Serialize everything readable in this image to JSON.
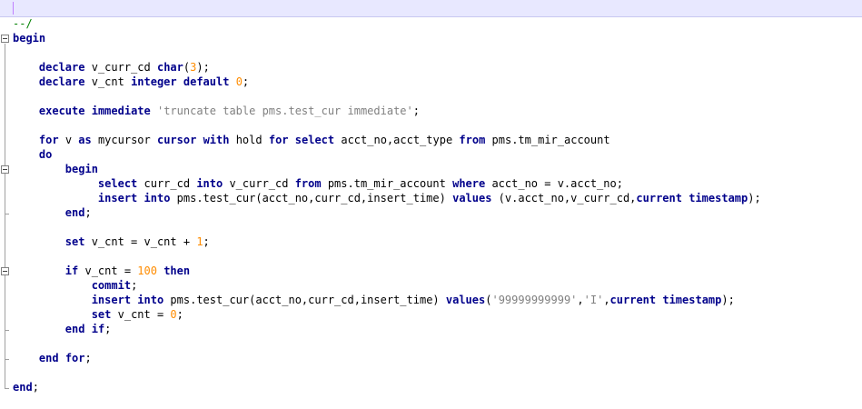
{
  "editor": {
    "lines": [
      [
        {
          "t": "--/",
          "c": "cm"
        }
      ],
      [
        {
          "t": "begin",
          "c": "kw"
        }
      ],
      [],
      [
        {
          "t": "    "
        },
        {
          "t": "declare",
          "c": "kw"
        },
        {
          "t": " v_curr_cd "
        },
        {
          "t": "char",
          "c": "kw"
        },
        {
          "t": "("
        },
        {
          "t": "3",
          "c": "num"
        },
        {
          "t": ");"
        }
      ],
      [
        {
          "t": "    "
        },
        {
          "t": "declare",
          "c": "kw"
        },
        {
          "t": " v_cnt "
        },
        {
          "t": "integer",
          "c": "kw"
        },
        {
          "t": " "
        },
        {
          "t": "default",
          "c": "kw"
        },
        {
          "t": " "
        },
        {
          "t": "0",
          "c": "num"
        },
        {
          "t": ";"
        }
      ],
      [],
      [
        {
          "t": "    "
        },
        {
          "t": "execute",
          "c": "kw"
        },
        {
          "t": " "
        },
        {
          "t": "immediate",
          "c": "kw"
        },
        {
          "t": " "
        },
        {
          "t": "'truncate table pms.test_cur immediate'",
          "c": "str"
        },
        {
          "t": ";"
        }
      ],
      [],
      [
        {
          "t": "    "
        },
        {
          "t": "for",
          "c": "kw"
        },
        {
          "t": " v "
        },
        {
          "t": "as",
          "c": "kw"
        },
        {
          "t": " mycursor "
        },
        {
          "t": "cursor",
          "c": "kw"
        },
        {
          "t": " "
        },
        {
          "t": "with",
          "c": "kw"
        },
        {
          "t": " hold "
        },
        {
          "t": "for",
          "c": "kw"
        },
        {
          "t": " "
        },
        {
          "t": "select",
          "c": "kw"
        },
        {
          "t": " acct_no,acct_type "
        },
        {
          "t": "from",
          "c": "kw"
        },
        {
          "t": " pms.tm_mir_account"
        }
      ],
      [
        {
          "t": "    "
        },
        {
          "t": "do",
          "c": "kw"
        }
      ],
      [
        {
          "t": "        "
        },
        {
          "t": "begin",
          "c": "kw"
        }
      ],
      [
        {
          "t": "             "
        },
        {
          "t": "select",
          "c": "kw"
        },
        {
          "t": " curr_cd "
        },
        {
          "t": "into",
          "c": "kw"
        },
        {
          "t": " v_curr_cd "
        },
        {
          "t": "from",
          "c": "kw"
        },
        {
          "t": " pms.tm_mir_account "
        },
        {
          "t": "where",
          "c": "kw"
        },
        {
          "t": " acct_no = v.acct_no;"
        }
      ],
      [
        {
          "t": "             "
        },
        {
          "t": "insert",
          "c": "kw"
        },
        {
          "t": " "
        },
        {
          "t": "into",
          "c": "kw"
        },
        {
          "t": " pms.test_cur(acct_no,curr_cd,insert_time) "
        },
        {
          "t": "values",
          "c": "kw"
        },
        {
          "t": " (v.acct_no,v_curr_cd,"
        },
        {
          "t": "current",
          "c": "kw"
        },
        {
          "t": " "
        },
        {
          "t": "timestamp",
          "c": "kw"
        },
        {
          "t": ");"
        }
      ],
      [
        {
          "t": "        "
        },
        {
          "t": "end",
          "c": "kw"
        },
        {
          "t": ";"
        }
      ],
      [],
      [
        {
          "t": "        "
        },
        {
          "t": "set",
          "c": "kw"
        },
        {
          "t": " v_cnt = v_cnt + "
        },
        {
          "t": "1",
          "c": "num"
        },
        {
          "t": ";"
        }
      ],
      [],
      [
        {
          "t": "        "
        },
        {
          "t": "if",
          "c": "kw"
        },
        {
          "t": " v_cnt = "
        },
        {
          "t": "100",
          "c": "num"
        },
        {
          "t": " "
        },
        {
          "t": "then",
          "c": "kw"
        }
      ],
      [
        {
          "t": "            "
        },
        {
          "t": "commit",
          "c": "kw"
        },
        {
          "t": ";"
        }
      ],
      [
        {
          "t": "            "
        },
        {
          "t": "insert",
          "c": "kw"
        },
        {
          "t": " "
        },
        {
          "t": "into",
          "c": "kw"
        },
        {
          "t": " pms.test_cur(acct_no,curr_cd,insert_time) "
        },
        {
          "t": "values",
          "c": "kw"
        },
        {
          "t": "("
        },
        {
          "t": "'99999999999'",
          "c": "str"
        },
        {
          "t": ","
        },
        {
          "t": "'I'",
          "c": "str"
        },
        {
          "t": ","
        },
        {
          "t": "current",
          "c": "kw"
        },
        {
          "t": " "
        },
        {
          "t": "timestamp",
          "c": "kw"
        },
        {
          "t": ");"
        }
      ],
      [
        {
          "t": "            "
        },
        {
          "t": "set",
          "c": "kw"
        },
        {
          "t": " v_cnt = "
        },
        {
          "t": "0",
          "c": "num"
        },
        {
          "t": ";"
        }
      ],
      [
        {
          "t": "        "
        },
        {
          "t": "end",
          "c": "kw"
        },
        {
          "t": " "
        },
        {
          "t": "if",
          "c": "kw"
        },
        {
          "t": ";"
        }
      ],
      [],
      [
        {
          "t": "    "
        },
        {
          "t": "end",
          "c": "kw"
        },
        {
          "t": " "
        },
        {
          "t": "for",
          "c": "kw"
        },
        {
          "t": ";"
        }
      ],
      [],
      [
        {
          "t": "end",
          "c": "kw"
        },
        {
          "t": ";"
        }
      ]
    ]
  },
  "colors": {
    "keyword": "#00008b",
    "comment": "#008000",
    "number": "#ff8c00",
    "string": "#808080",
    "current_line": "#e8e8ff"
  }
}
